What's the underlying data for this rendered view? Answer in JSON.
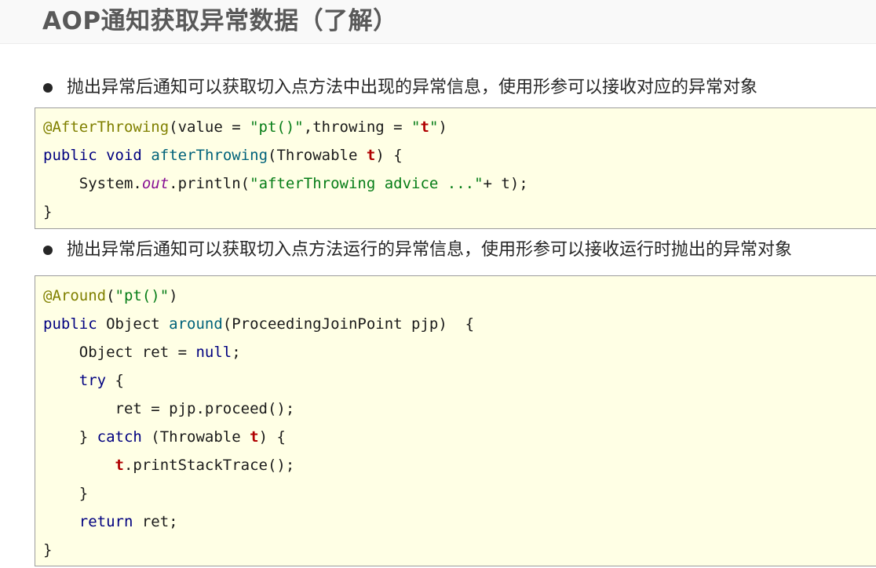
{
  "title": "AOP通知获取异常数据（了解）",
  "bullets": [
    "抛出异常后通知可以获取切入点方法中出现的异常信息，使用形参可以接收对应的异常对象",
    "抛出异常后通知可以获取切入点方法运行的异常信息，使用形参可以接收运行时抛出的异常对象"
  ],
  "code_block_1": {
    "tokens": {
      "l1_ann": "@AfterThrowing",
      "l1_a": "(value = ",
      "l1_s1": "\"pt()\"",
      "l1_b": ",throwing = ",
      "l1_s2a": "\"",
      "l1_s2b": "t",
      "l1_s2c": "\"",
      "l1_c": ")",
      "l2_kw1": "public",
      "l2_sp1": " ",
      "l2_kw2": "void",
      "l2_sp2": " ",
      "l2_fn": "afterThrowing",
      "l2_a": "(Throwable ",
      "l2_p": "t",
      "l2_b": ") {",
      "l3_a": "    System.",
      "l3_fld": "out",
      "l3_b": ".println(",
      "l3_s": "\"afterThrowing advice ...\"",
      "l3_c": "+ t);",
      "l4": "}"
    }
  },
  "code_block_2": {
    "tokens": {
      "l1_ann": "@Around",
      "l1_a": "(",
      "l1_s": "\"pt()\"",
      "l1_b": ")",
      "l2_kw": "public",
      "l2_a": " Object ",
      "l2_fn": "around",
      "l2_b": "(ProceedingJoinPoint pjp)  {",
      "l3_a": "    Object ret = ",
      "l3_kw": "null",
      "l3_b": ";",
      "l4_sp": "    ",
      "l4_kw": "try",
      "l4_b": " {",
      "l5": "        ret = pjp.proceed();",
      "l6_a": "    } ",
      "l6_kw": "catch",
      "l6_b": " (Throwable ",
      "l6_p": "t",
      "l6_c": ") {",
      "l7_sp": "        ",
      "l7_p": "t",
      "l7_b": ".printStackTrace();",
      "l8": "    }",
      "l9_sp": "    ",
      "l9_kw": "return",
      "l9_b": " ret;",
      "l10": "}"
    }
  }
}
